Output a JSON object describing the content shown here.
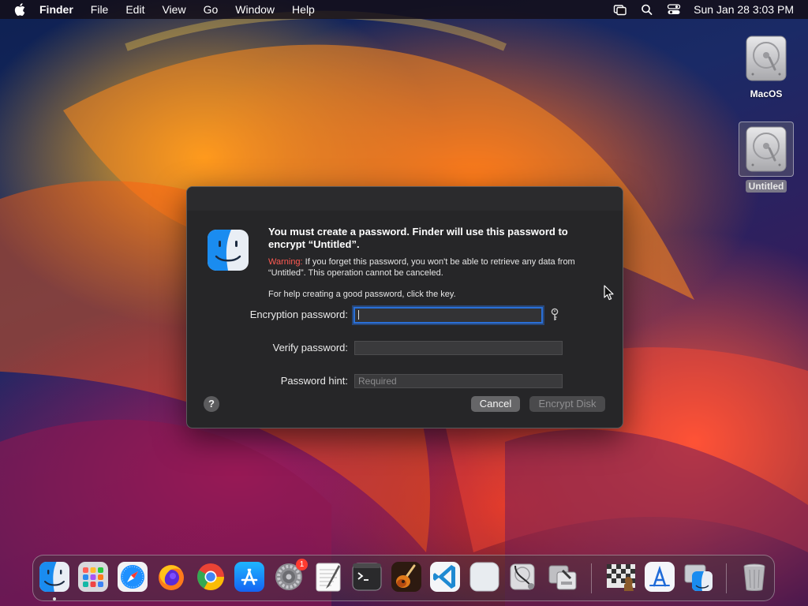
{
  "menubar": {
    "app_name": "Finder",
    "items": [
      "File",
      "Edit",
      "View",
      "Go",
      "Window",
      "Help"
    ],
    "clock": "Sun Jan 28  3:03 PM"
  },
  "desktop": {
    "icons": [
      {
        "label": "MacOS",
        "selected": false,
        "icon": "hard-drive-icon"
      },
      {
        "label": "Untitled",
        "selected": true,
        "icon": "hard-drive-icon"
      }
    ]
  },
  "dialog": {
    "headline": "You must create a password. Finder will use this password to encrypt “Untitled”.",
    "warning_label": "Warning:",
    "warning_text": " If you forget this password, you won't be able to retrieve any data from “Untitled”. This operation cannot be canceled.",
    "help_text": "For help creating a good password, click the key.",
    "fields": {
      "encryption_label": "Encryption password:",
      "encryption_value": "",
      "verify_label": "Verify password:",
      "verify_value": "",
      "hint_label": "Password hint:",
      "hint_placeholder": "Required"
    },
    "help_button": "?",
    "cancel_label": "Cancel",
    "encrypt_label": "Encrypt Disk"
  },
  "dock": {
    "badges": {
      "system_settings": "1"
    },
    "items": [
      "finder-icon",
      "launchpad-icon",
      "safari-icon",
      "firefox-icon",
      "chrome-icon",
      "app-store-icon",
      "system-settings-icon",
      "textedit-icon",
      "terminal-icon",
      "garageband-icon",
      "vscode-icon",
      "blank-app-icon",
      "disk-utility-icon",
      "boot-camp-icon",
      "chess-icon",
      "xcode-instruments-icon",
      "finder-alt-icon",
      "trash-icon"
    ]
  },
  "colors": {
    "accent": "#2a6fd6",
    "warning": "#ff5a52",
    "dialog_bg": "#262628",
    "badge": "#ff3b30"
  }
}
